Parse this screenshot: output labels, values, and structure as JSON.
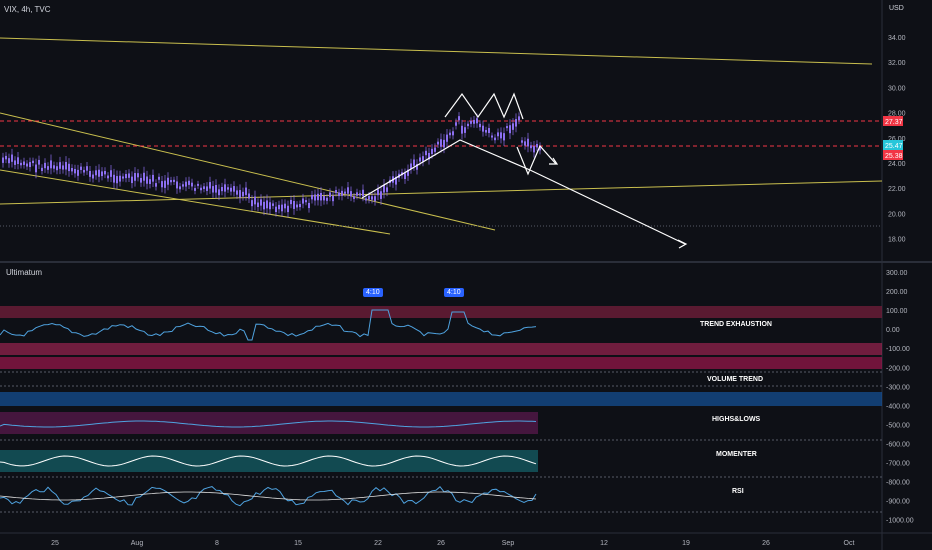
{
  "header": {
    "symbol_line": "VIX, 4h, TVC",
    "currency": "USD"
  },
  "indicator": {
    "name": "Ultimatum"
  },
  "price_axis": {
    "ticks": [
      "34.00",
      "32.00",
      "30.00",
      "28.00",
      "26.00",
      "24.00",
      "22.00",
      "20.00",
      "18.00"
    ]
  },
  "price_tags": [
    {
      "label": "27.37",
      "color": "#f23645"
    },
    {
      "label": "25.47",
      "color": "#26c6da"
    },
    {
      "label": "25.38",
      "color": "#f23645"
    }
  ],
  "indicator_axis": {
    "ticks": [
      "300.00",
      "200.00",
      "100.00",
      "0.00",
      "-100.00",
      "-200.00",
      "-300.00",
      "-400.00",
      "-500.00",
      "-600.00",
      "-700.00",
      "-800.00",
      "-900.00",
      "-1000.00"
    ]
  },
  "time_axis": {
    "ticks": [
      "25",
      "Aug",
      "8",
      "15",
      "22",
      "26",
      "Sep",
      "12",
      "19",
      "26",
      "Oct"
    ]
  },
  "panes": {
    "trend_exhaustion": "TREND EXHAUSTION",
    "volume_trend": "VOLUME TREND",
    "highs_lows": "HIGHS&LOWS",
    "momenter": "MOMENTER",
    "rsi": "RSI"
  },
  "signal_tags": [
    {
      "label": "4:10",
      "color": "#2962ff"
    },
    {
      "label": "4:10",
      "color": "#2962ff"
    }
  ],
  "colors": {
    "bg": "#0e1016",
    "candle": "#8c6ff0",
    "trendline": "#c9bf4e",
    "dash": "#f23645",
    "white": "#ffffff"
  }
}
